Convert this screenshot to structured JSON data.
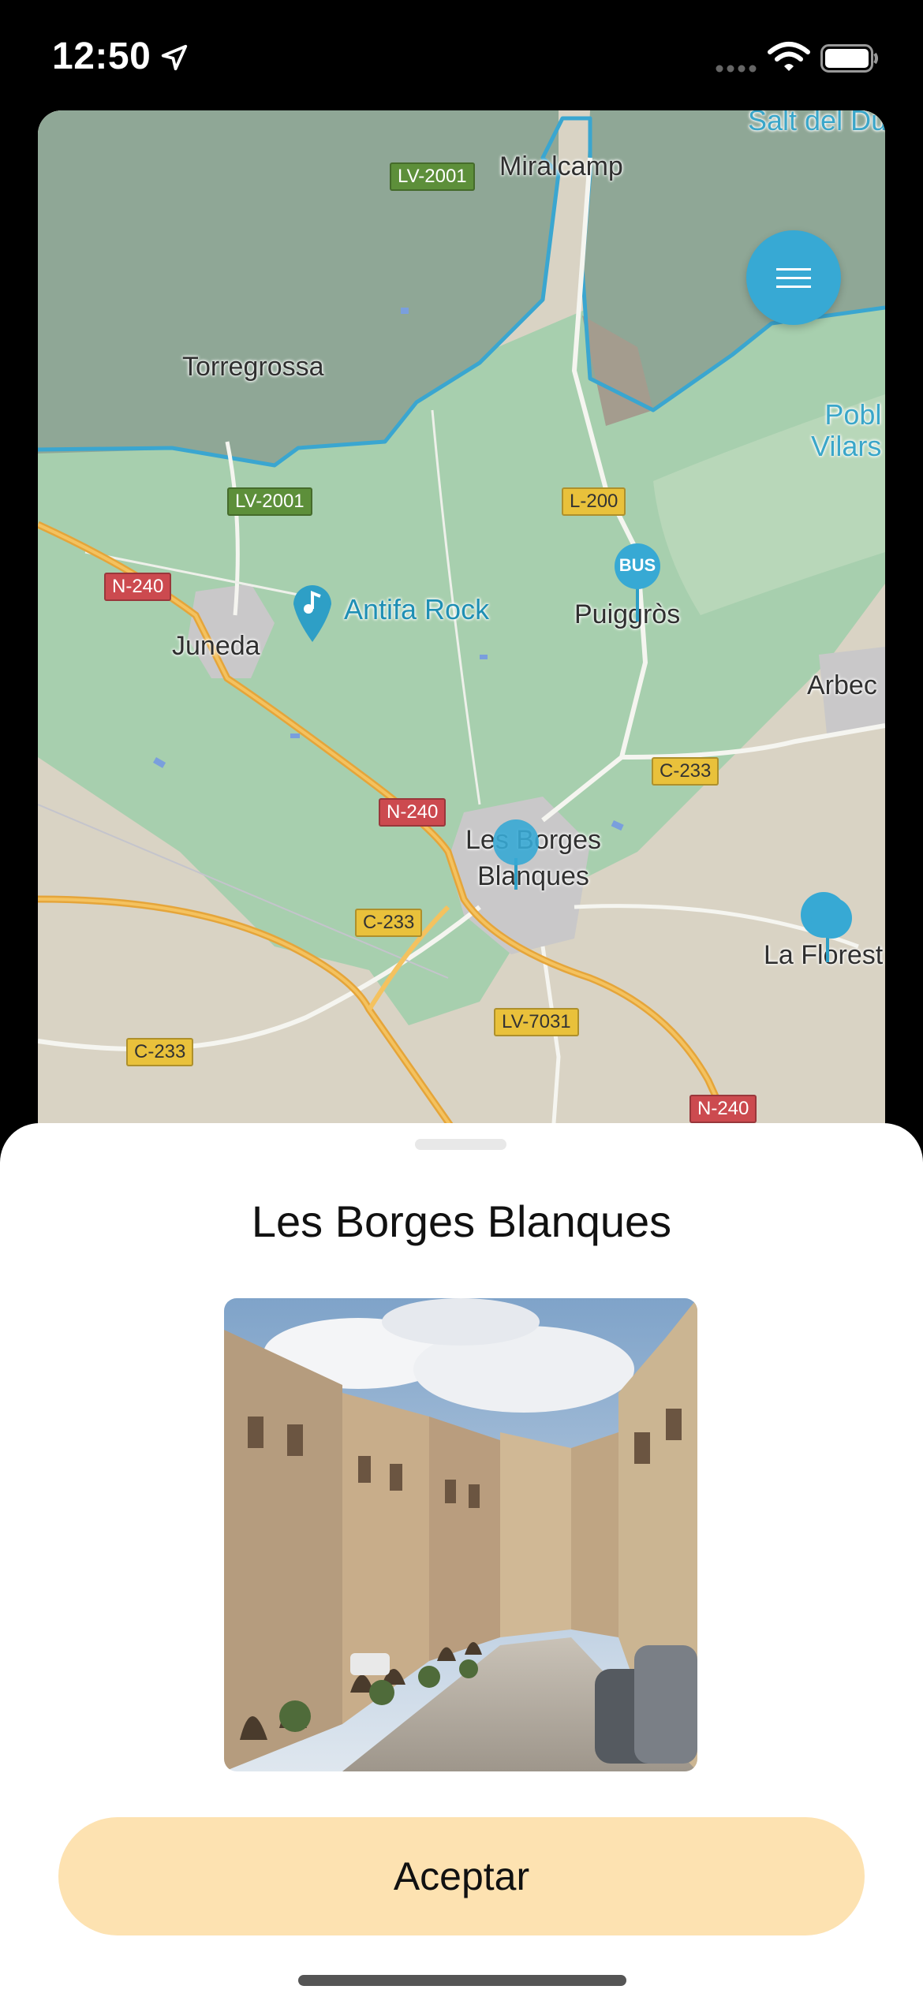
{
  "status_bar": {
    "time": "12:50"
  },
  "map": {
    "places": {
      "miralcamp": "Miralcamp",
      "torregrossa": "Torregrossa",
      "juneda": "Juneda",
      "puiggros": "Puiggròs",
      "borges": "Les Borges\nBlanques",
      "arbeca": "Arbec",
      "la_floresta": "La Florest",
      "salt": "Salt del Du",
      "pobla": "Pobl\nVilars"
    },
    "poi_antifa": "Antifa Rock",
    "bus_label": "BUS",
    "roads": {
      "lv2001_top": "LV-2001",
      "lv2001_mid": "LV-2001",
      "l200": "L-200",
      "n240_left": "N-240",
      "n240_mid": "N-240",
      "n240_bottom": "N-240",
      "c233_right": "C-233",
      "c233_mid": "C-233",
      "c233_left": "C-233",
      "lv7031": "LV-7031"
    },
    "colors": {
      "accent": "#37a9d4",
      "green_area": "#a7cfae",
      "dark_area": "#8fa796",
      "land": "#d9d3c4"
    },
    "menu_icon": "menu-lines-icon"
  },
  "sheet": {
    "title": "Les Borges Blanques",
    "photo_icon": "street-photo",
    "accept_label": "Aceptar",
    "accept_color": "#fde2b1"
  }
}
